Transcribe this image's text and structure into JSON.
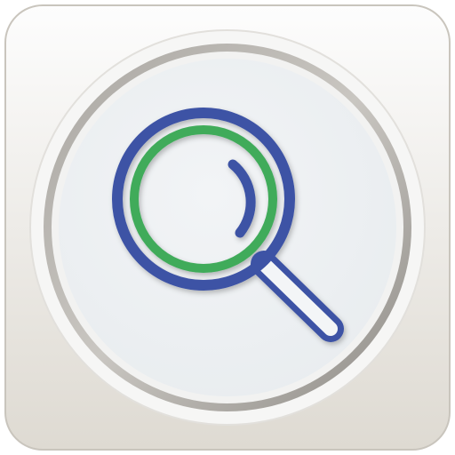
{
  "icon": {
    "semantic": "magnifying-glass-icon",
    "colors": {
      "tile_top": "#fdfdfd",
      "tile_bottom": "#dedad2",
      "tile_edge": "#c9c5bd",
      "bezel_light": "#f4f4f4",
      "bezel_mid": "#a9a6a1",
      "bezel_dark": "#8e8b86",
      "face": "#e8ecef",
      "lens_outer": "#3d53a5",
      "lens_inner": "#3fab5a",
      "handle": "#3d53a5",
      "handle_fill": "#f3f5f7"
    }
  }
}
